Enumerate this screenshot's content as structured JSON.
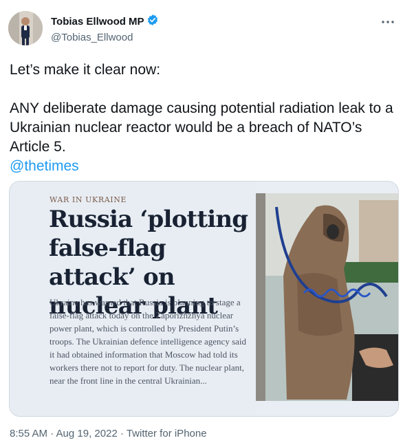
{
  "author": {
    "name": "Tobias Ellwood MP",
    "handle": "@Tobias_Ellwood",
    "verified": true
  },
  "tweet": {
    "line1": "Let’s make it clear now:",
    "line2": "ANY deliberate damage causing potential radiation leak to a Ukrainian nuclear reactor would be a breach of NATO’s Article 5.",
    "mention": "@thetimes"
  },
  "media": {
    "kicker": "WAR IN UKRAINE",
    "headline": "Russia ‘plotting false-flag attack’ on nuclear plant",
    "body": "Ukraine has warned that Russia is planning to stage a false-flag attack today on the Zaporizhzhya nuclear power plant, which is controlled by President Putin’s troops. The Ukrainian defence intelligence agency said it had obtained information that Moscow had told its workers there not to report for duty. The nuclear plant, near the front line in the central Ukrainian...",
    "photo_subject": "worker in protective suit with blue hose"
  },
  "meta": {
    "timestamp": "8:55 AM · Aug 19, 2022 · Twitter for iPhone"
  },
  "colors": {
    "link": "#1d9bf0",
    "verified_badge": "#1d9bf0",
    "secondary_text": "#536471",
    "headline_ink": "#182233"
  },
  "icons": {
    "verified": "verified-badge-icon",
    "more": "more-options-icon"
  }
}
